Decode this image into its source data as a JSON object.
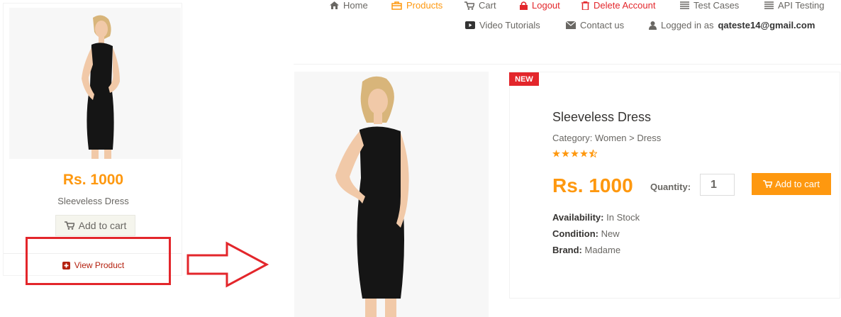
{
  "left_card": {
    "price": "Rs. 1000",
    "name": "Sleeveless Dress",
    "add_to_cart": "Add to cart",
    "view_product": "View Product"
  },
  "nav": {
    "items": [
      {
        "label": "Home",
        "icon": "home-icon"
      },
      {
        "label": "Products",
        "icon": "products-icon",
        "active": true
      },
      {
        "label": "Cart",
        "icon": "cart-icon"
      },
      {
        "label": "Logout",
        "icon": "lock-icon"
      },
      {
        "label": "Delete Account",
        "icon": "trash-icon"
      },
      {
        "label": "Test Cases",
        "icon": "list-icon"
      },
      {
        "label": "API Testing",
        "icon": "list-icon"
      },
      {
        "label": "Video Tutorials",
        "icon": "youtube-icon"
      },
      {
        "label": "Contact us",
        "icon": "envelope-icon"
      }
    ],
    "logged_in_prefix": "Logged in as",
    "logged_in_user": "qateste14@gmail.com"
  },
  "product": {
    "badge": "NEW",
    "name": "Sleeveless Dress",
    "category": "Category: Women > Dress",
    "rating": 4.5,
    "price": "Rs. 1000",
    "quantity_label": "Quantity:",
    "quantity_value": "1",
    "add_to_cart": "Add to cart",
    "availability_label": "Availability:",
    "availability_value": "In Stock",
    "condition_label": "Condition:",
    "condition_value": "New",
    "brand_label": "Brand:",
    "brand_value": "Madame"
  },
  "colors": {
    "accent": "#fe980f",
    "highlight_box": "#e3262b",
    "badge": "#e3262b",
    "view_product": "#b4200e"
  }
}
